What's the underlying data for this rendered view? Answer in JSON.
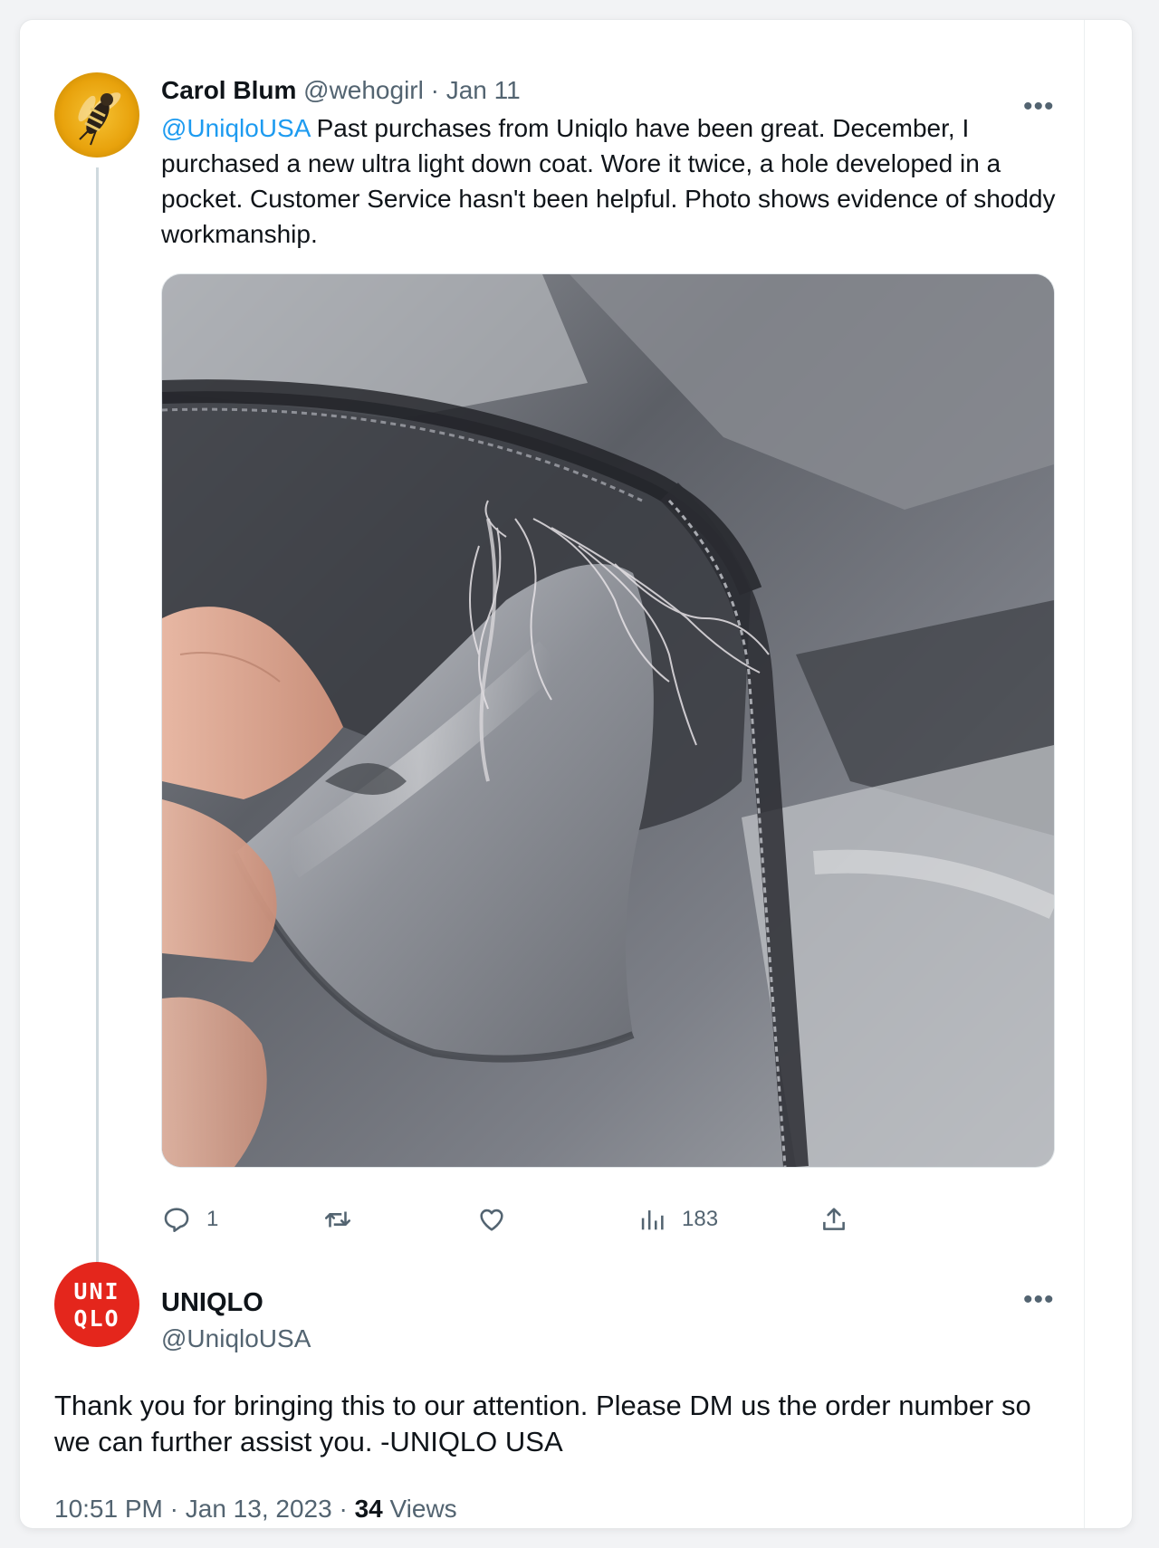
{
  "original_tweet": {
    "author_name": "Carol Blum",
    "handle": "@wehogirl",
    "separator": "·",
    "date": "Jan 11",
    "mention": "@UniqloUSA",
    "text": " Past purchases from Uniqlo have been great.  December, I purchased a new ultra light down coat. Wore it twice, a hole developed in a pocket. Customer Service hasn't been helpful. Photo shows evidence of shoddy workmanship.",
    "avatar_icon": "hoverfly-avatar",
    "image_icon": "torn-jacket-pocket-photo",
    "more_icon": "more-dots-icon",
    "actions": {
      "reply_count": "1",
      "retweet_count": "",
      "like_count": "",
      "views_count": "183"
    }
  },
  "reply_tweet": {
    "author_name": "UNIQLO",
    "handle": "@UniqloUSA",
    "logo_line1": "UNI",
    "logo_line2": "QLO",
    "text": "Thank you for bringing this to our attention. Please DM us the order number so we can further assist you. -UNIQLO USA",
    "time": "10:51 PM",
    "separator": "·",
    "date": "Jan 13, 2023",
    "views_count": "34",
    "views_label": "Views",
    "more_icon": "more-dots-icon"
  },
  "colors": {
    "accent": "#1d9bf0",
    "text": "#0f1419",
    "muted": "#536471",
    "uniqlo_red": "#e4261c"
  }
}
